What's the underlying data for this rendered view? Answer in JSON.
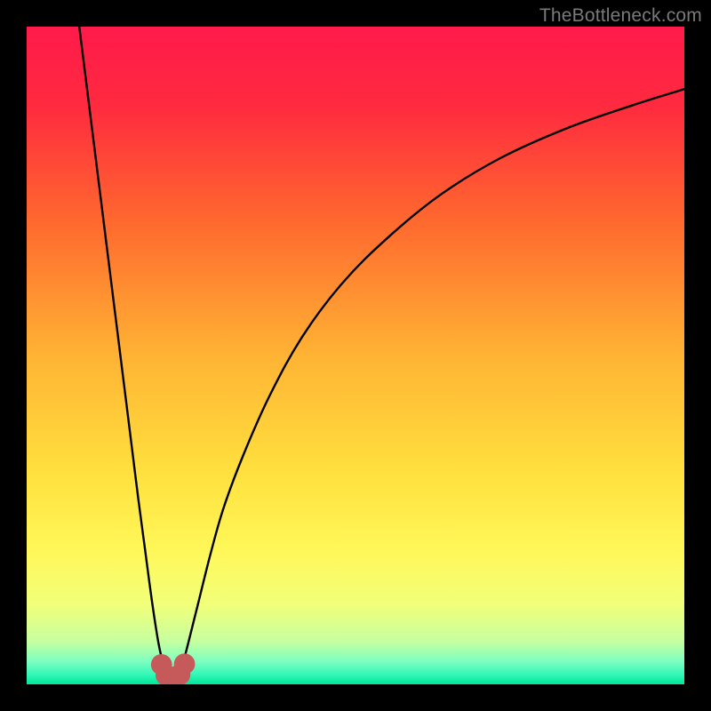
{
  "watermark": "TheBottleneck.com",
  "chart_data": {
    "type": "line",
    "title": "",
    "xlabel": "",
    "ylabel": "",
    "xlim": [
      0,
      100
    ],
    "ylim": [
      0,
      100
    ],
    "gradient_stops": [
      {
        "offset": 0.0,
        "color": "#ff1a4b"
      },
      {
        "offset": 0.12,
        "color": "#ff2a3f"
      },
      {
        "offset": 0.3,
        "color": "#ff6a2e"
      },
      {
        "offset": 0.5,
        "color": "#ffb334"
      },
      {
        "offset": 0.68,
        "color": "#ffe13e"
      },
      {
        "offset": 0.8,
        "color": "#fff85a"
      },
      {
        "offset": 0.88,
        "color": "#f1ff7a"
      },
      {
        "offset": 0.935,
        "color": "#c6ffa0"
      },
      {
        "offset": 0.965,
        "color": "#7dffc0"
      },
      {
        "offset": 0.985,
        "color": "#34f7b6"
      },
      {
        "offset": 1.0,
        "color": "#00e79a"
      }
    ],
    "series": [
      {
        "name": "left-branch",
        "x": [
          8,
          9,
          10,
          11,
          12,
          13,
          14,
          15,
          16,
          17,
          18,
          19,
          20,
          20.7
        ],
        "values": [
          100,
          92,
          84,
          76,
          68,
          60,
          52,
          44,
          36,
          28,
          20.5,
          13,
          6.5,
          3.3
        ]
      },
      {
        "name": "right-branch",
        "x": [
          23.8,
          24.5,
          26,
          28,
          30,
          33,
          37,
          42,
          48,
          55,
          63,
          72,
          82,
          92,
          100
        ],
        "values": [
          3.3,
          6,
          12,
          20,
          27,
          35,
          44,
          53,
          61,
          68,
          74.5,
          80,
          84.5,
          88,
          90.5
        ]
      }
    ],
    "markers": [
      {
        "name": "dip-left",
        "x": 20.5,
        "y": 3.0,
        "r": 1.6,
        "color": "#c65a5a"
      },
      {
        "name": "dip-mid-l",
        "x": 21.2,
        "y": 1.4,
        "r": 1.6,
        "color": "#c65a5a"
      },
      {
        "name": "dip-mid",
        "x": 22.3,
        "y": 1.0,
        "r": 1.6,
        "color": "#c65a5a"
      },
      {
        "name": "dip-mid-r",
        "x": 23.3,
        "y": 1.5,
        "r": 1.6,
        "color": "#c65a5a"
      },
      {
        "name": "dip-right",
        "x": 24.0,
        "y": 3.1,
        "r": 1.6,
        "color": "#c65a5a"
      }
    ],
    "dip_path": {
      "x": [
        20.5,
        21.0,
        21.6,
        22.3,
        23.0,
        23.6,
        24.0
      ],
      "values": [
        3.1,
        1.8,
        1.1,
        0.9,
        1.2,
        2.0,
        3.2
      ],
      "color": "#c65a5a",
      "width": 1.6
    }
  }
}
